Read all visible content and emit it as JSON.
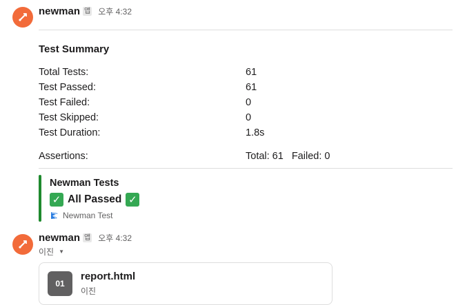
{
  "messages": [
    {
      "sender": "newman",
      "app_badge": "앱",
      "time": "오후 4:32",
      "summary": {
        "title": "Test Summary",
        "rows": [
          {
            "label": "Total Tests:",
            "value": "61"
          },
          {
            "label": "Test Passed:",
            "value": "61"
          },
          {
            "label": "Test Failed:",
            "value": "0"
          },
          {
            "label": "Test Skipped:",
            "value": "0"
          },
          {
            "label": "Test Duration:",
            "value": "1.8s"
          }
        ],
        "assertions": {
          "label": "Assertions:",
          "total": "Total: 61",
          "failed": "Failed: 0"
        }
      },
      "attachment": {
        "accent_color": "#1f8a2e",
        "title": "Newman Tests",
        "status_text": "All Passed",
        "status_icon": "white-heavy-check-mark-icon",
        "footer_icon": "newman-flag-icon",
        "footer_text": "Newman Test"
      }
    },
    {
      "sender": "newman",
      "app_badge": "앱",
      "time": "오후 4:32",
      "shared_by": "이진",
      "file": {
        "icon_text": "01",
        "name": "report.html",
        "owner": "이진"
      }
    }
  ],
  "colors": {
    "avatar": "#f26b3a",
    "attachment_bar": "#1f8a2e",
    "check_emoji": "#34a853"
  }
}
